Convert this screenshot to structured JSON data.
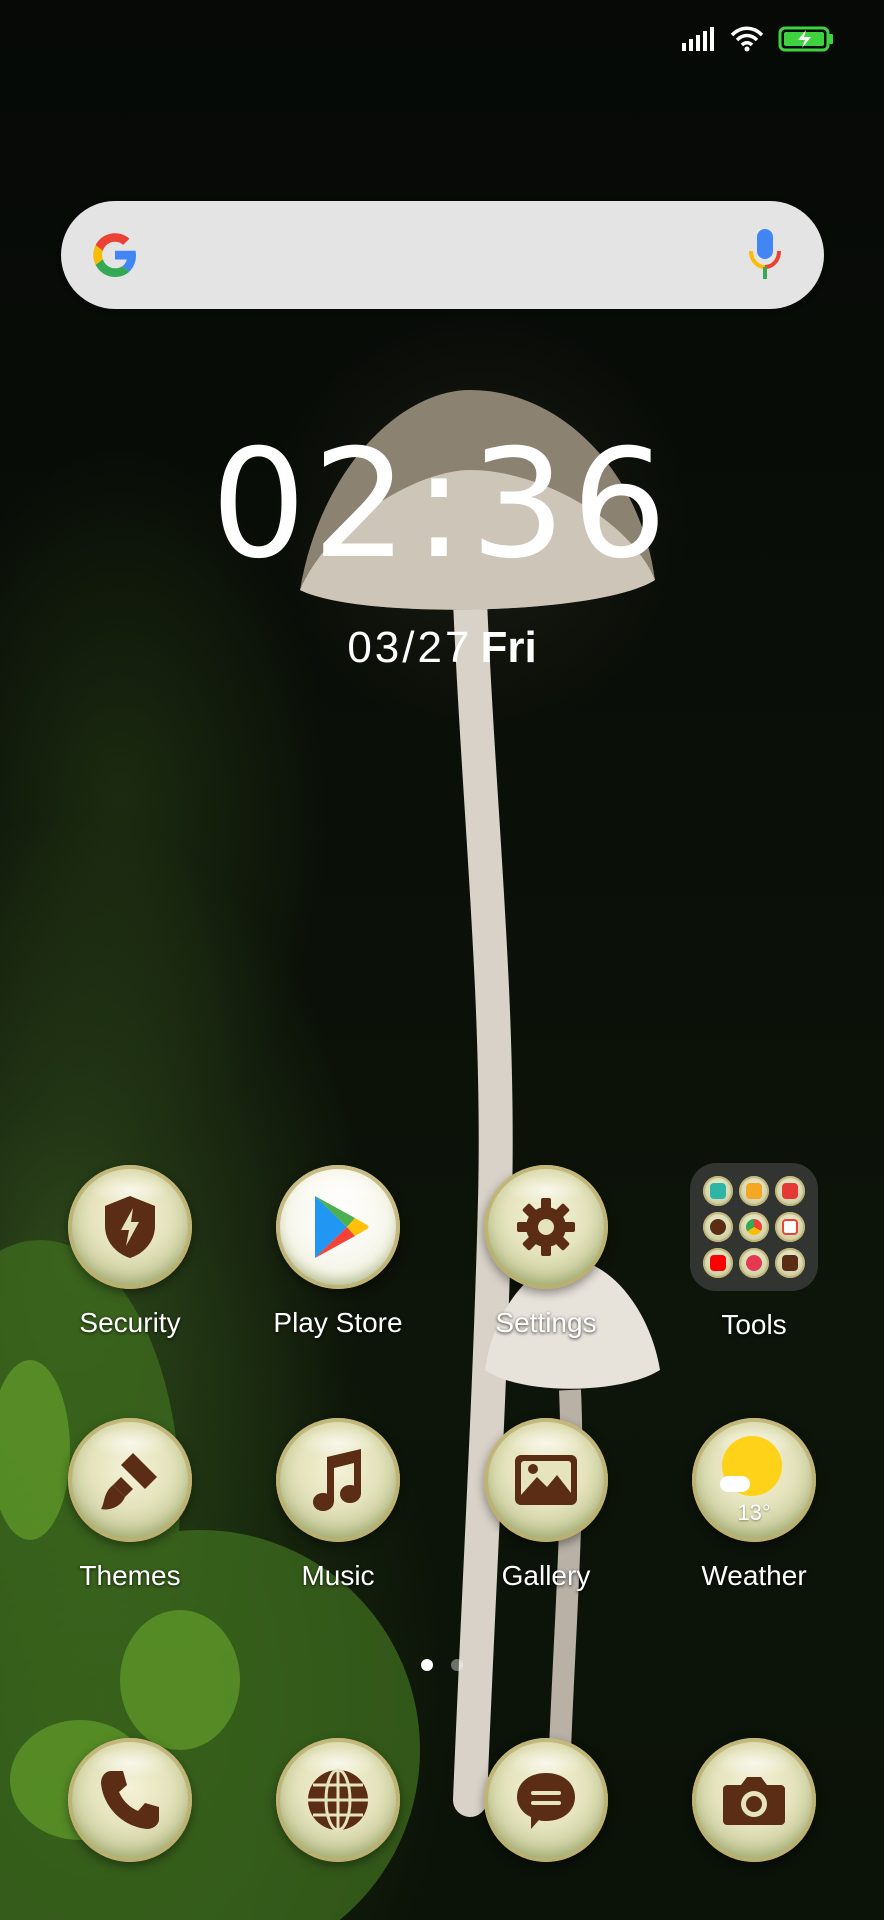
{
  "status_bar": {
    "icons": [
      "signal-icon",
      "wifi-icon",
      "battery-charging-icon"
    ],
    "battery_color": "#3ed33e"
  },
  "search": {
    "logo": "google-g-icon",
    "mic": "microphone-icon"
  },
  "clock": {
    "hours": "02",
    "separator": ":",
    "minutes": "36",
    "date": "03/27",
    "weekday": "Fri"
  },
  "apps_row1": [
    {
      "label": "Security",
      "icon": "shield-bolt-icon"
    },
    {
      "label": "Play Store",
      "icon": "play-store-icon"
    },
    {
      "label": "Settings",
      "icon": "gear-icon"
    },
    {
      "label": "Tools",
      "icon": "folder-icon"
    }
  ],
  "apps_row2": [
    {
      "label": "Themes",
      "icon": "paintbrush-icon"
    },
    {
      "label": "Music",
      "icon": "music-note-icon"
    },
    {
      "label": "Gallery",
      "icon": "picture-icon"
    },
    {
      "label": "Weather",
      "icon": "sun-cloud-icon",
      "temperature": "13°"
    }
  ],
  "dock": [
    {
      "icon": "phone-icon"
    },
    {
      "icon": "globe-icon"
    },
    {
      "icon": "message-icon"
    },
    {
      "icon": "camera-icon"
    }
  ],
  "pages": {
    "count": 2,
    "active": 1
  },
  "colors": {
    "icon_glyph": "#5a2d14",
    "bubble": "#e5e4bd",
    "weather_sun": "#ffd21a"
  }
}
